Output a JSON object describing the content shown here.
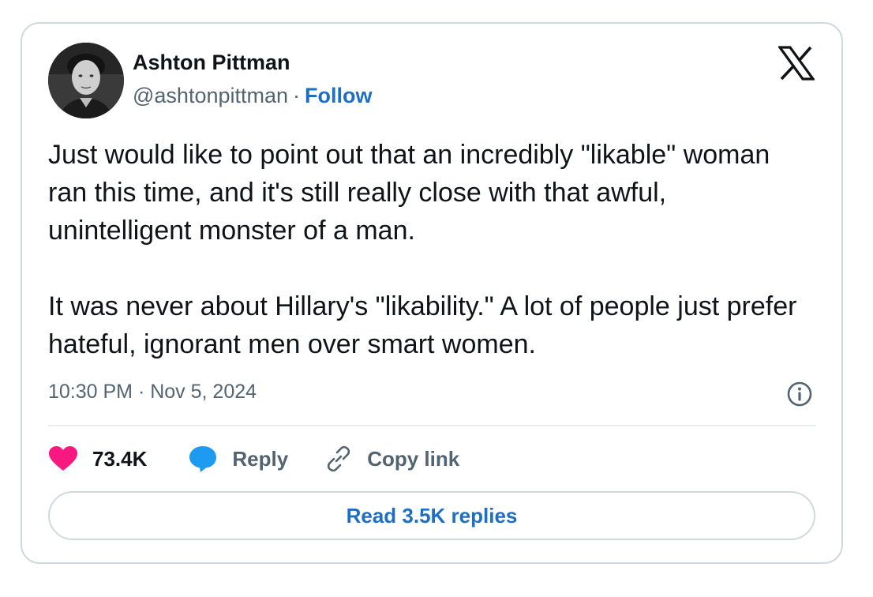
{
  "author": {
    "name": "Ashton Pittman",
    "handle": "@ashtonpittman",
    "separator": "·",
    "follow_label": "Follow",
    "avatar_icon": "avatar-photo"
  },
  "logo": "x-logo-icon",
  "tweet": {
    "paragraph_1": "Just would like to point out that an incredibly \"likable\" woman ran this time, and it's still really close with that awful, unintelligent monster of a man.",
    "paragraph_2": "It was never about Hillary's \"likability.\" A lot of people just prefer hateful, ignorant men over smart women.",
    "timestamp": "10:30 PM · Nov 5, 2024"
  },
  "actions": {
    "likes_count": "73.4K",
    "reply_label": "Reply",
    "copy_link_label": "Copy link"
  },
  "read_replies_label": "Read 3.5K replies",
  "colors": {
    "accent": "#1d6fc4",
    "like": "#f91880",
    "reply_icon": "#1d9bf0",
    "muted": "#536471",
    "border": "#cfd9de"
  }
}
